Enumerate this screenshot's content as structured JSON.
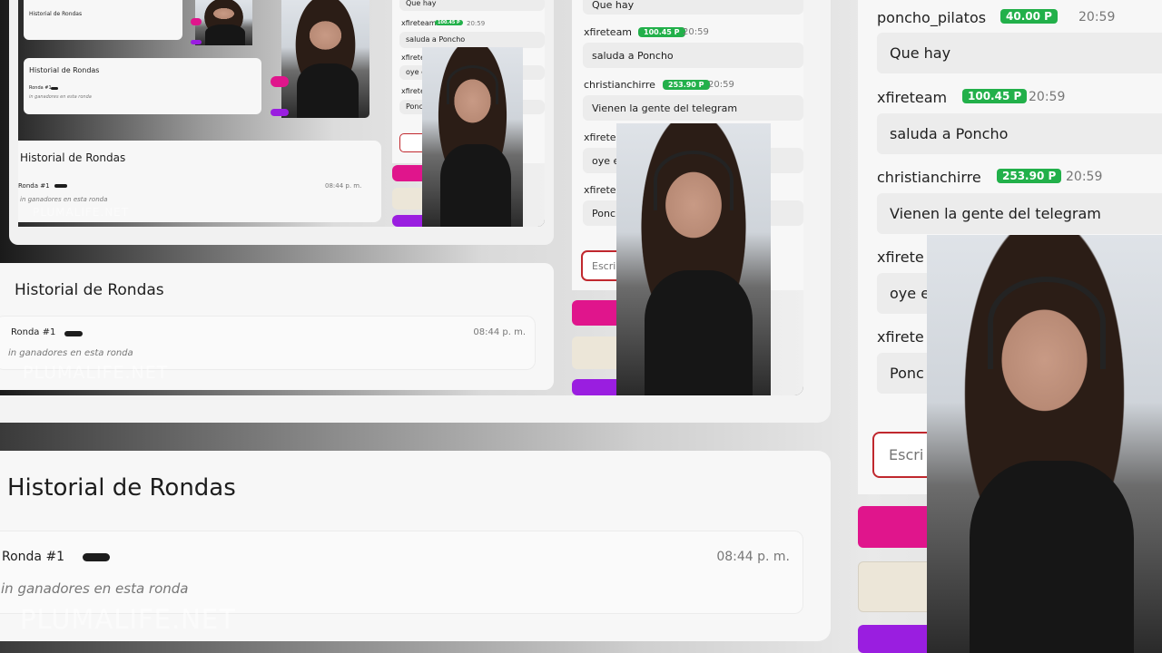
{
  "history": {
    "title": "Historial de Rondas",
    "round_label": "Ronda #1",
    "empty_text": "in ganadores en esta ronda",
    "time": "08:44 p. m."
  },
  "watermark": "PLUMALIFE.NET",
  "chat": {
    "messages": [
      {
        "user": "poncho_pilatos",
        "badge": "40.00 P",
        "time": "20:59",
        "text": "Que hay"
      },
      {
        "user": "xfireteam",
        "badge": "100.45 P",
        "time": "20:59",
        "text": "saluda a Poncho"
      },
      {
        "user": "christianchirre",
        "badge": "253.90 P",
        "time": "20:59",
        "text": "Vienen la gente del telegram"
      },
      {
        "user": "xfirete",
        "text": "oye e"
      },
      {
        "user": "xfirete",
        "text": "Ponc"
      }
    ],
    "input_placeholder": "Escri",
    "mid_input_placeholder": "Escri"
  },
  "colors": {
    "badge": "#22b04a",
    "magenta": "#e0158c",
    "beige": "#ece6d8",
    "purple": "#9a1ee0",
    "input_border": "#c0282e"
  }
}
